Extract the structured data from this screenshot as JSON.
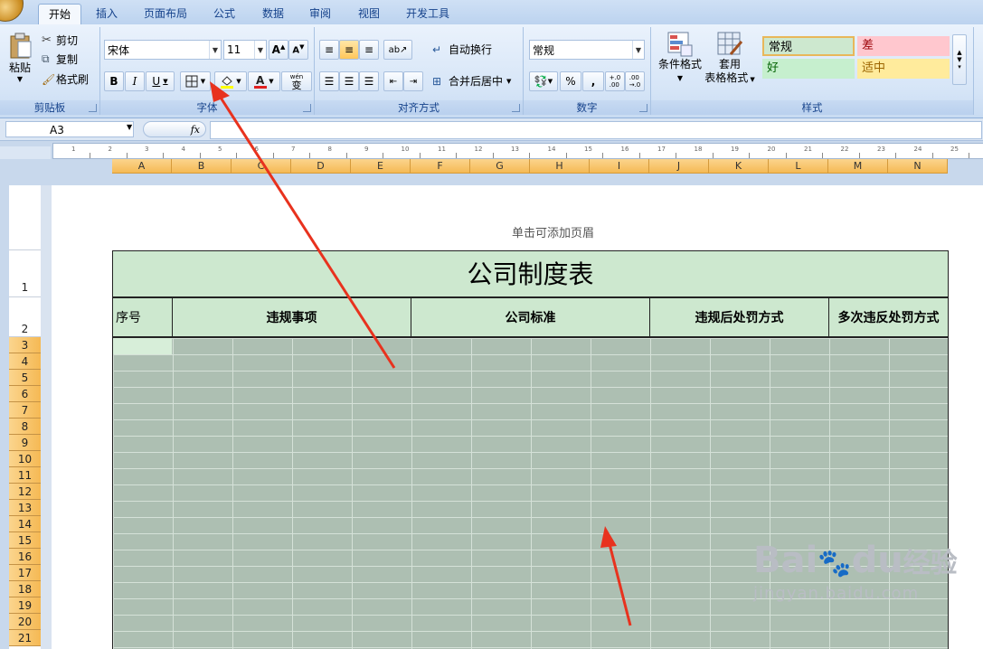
{
  "tabs": [
    "开始",
    "插入",
    "页面布局",
    "公式",
    "数据",
    "审阅",
    "视图",
    "开发工具"
  ],
  "clipboard": {
    "paste": "粘贴",
    "cut": "剪切",
    "copy": "复制",
    "format_painter": "格式刷",
    "label": "剪贴板"
  },
  "font": {
    "name": "宋体",
    "size": "11",
    "bold": "B",
    "italic": "I",
    "underline": "U",
    "label": "字体",
    "phonetic": "wén",
    "phonetic_char": "变"
  },
  "alignment": {
    "wrap": "自动换行",
    "merge": "合并后居中",
    "label": "对齐方式"
  },
  "number": {
    "format": "常规",
    "percent": "%",
    "comma": ",",
    "inc": "+.0\n.00",
    "dec": ".00\n→.0",
    "label": "数字"
  },
  "styles": {
    "cond": "条件格式",
    "table_1": "套用",
    "table_2": "表格格式",
    "normal": "常规",
    "bad": "差",
    "good": "好",
    "neutral": "适中",
    "label": "样式"
  },
  "formula_bar": {
    "name_box": "A3",
    "fx": "fx"
  },
  "ruler_numbers": [
    "1",
    "2",
    "3",
    "4",
    "5",
    "6",
    "7",
    "8",
    "9",
    "10",
    "11",
    "12",
    "13",
    "14",
    "15",
    "16",
    "17",
    "18",
    "19",
    "20",
    "21",
    "22",
    "23",
    "24",
    "25"
  ],
  "columns": [
    "A",
    "B",
    "C",
    "D",
    "E",
    "F",
    "G",
    "H",
    "I",
    "J",
    "K",
    "L",
    "M",
    "N"
  ],
  "rows": [
    "1",
    "2",
    "3",
    "4",
    "5",
    "6",
    "7",
    "8",
    "9",
    "10",
    "11",
    "12",
    "13",
    "14",
    "15",
    "16",
    "17",
    "18",
    "19",
    "20",
    "21"
  ],
  "sheet": {
    "header_hint": "单击可添加页眉",
    "title": "公司制度表",
    "headers": [
      "序号",
      "违规事项",
      "公司标准",
      "违规后处罚方式",
      "多次违反处罚方式"
    ]
  },
  "watermark": {
    "brand": "Bai",
    "brand_mid": "du",
    "brand_cn": "经验",
    "url": "jingyan.baidu.com"
  },
  "colors": {
    "title_fill": "#cde8cf",
    "grid_fill": "#adbfb2",
    "arrow": "#e8321e",
    "col_header": "#f5b954"
  }
}
